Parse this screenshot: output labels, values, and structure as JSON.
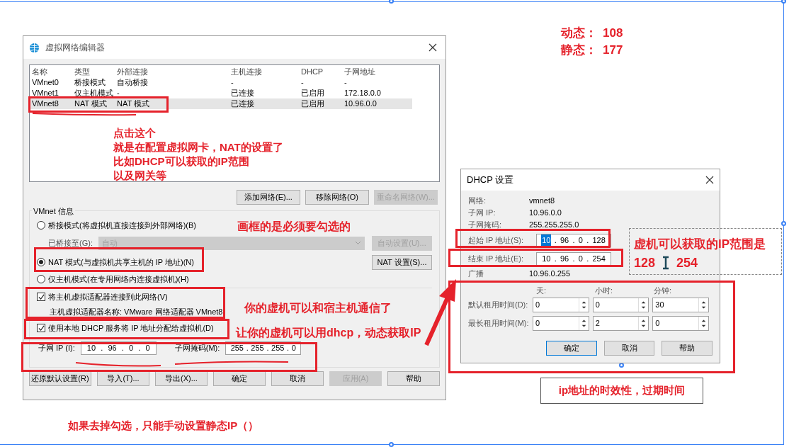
{
  "main_dialog": {
    "title": "虚拟网络编辑器",
    "table": {
      "columns": [
        "名称",
        "类型",
        "外部连接",
        "主机连接",
        "DHCP",
        "子网地址"
      ],
      "rows": [
        {
          "cells": [
            "VMnet0",
            "桥接模式",
            "自动桥接",
            "-",
            "-",
            "-"
          ],
          "selected": false
        },
        {
          "cells": [
            "VMnet1",
            "仅主机模式",
            "-",
            "已连接",
            "已启用",
            "172.18.0.0"
          ],
          "selected": false
        },
        {
          "cells": [
            "VMnet8",
            "NAT 模式",
            "NAT 模式",
            "已连接",
            "已启用",
            "10.96.0.0"
          ],
          "selected": true
        }
      ]
    },
    "list_buttons": [
      {
        "label": "添加网络(E)...",
        "disabled": false
      },
      {
        "label": "移除网络(O)",
        "disabled": false
      },
      {
        "label": "重命名网络(W)...",
        "disabled": true
      }
    ],
    "group_title": "VMnet 信息",
    "radios": [
      {
        "label": "桥接模式(将虚拟机直接连接到外部网络)(B)",
        "selected": false
      },
      {
        "label": "NAT 模式(与虚拟机共享主机的 IP 地址)(N)",
        "selected": true
      },
      {
        "label": "仅主机模式(在专用网络内连接虚拟机)(H)",
        "selected": false
      }
    ],
    "bridged_to": {
      "label": "已桥接至(G):",
      "value": "自动",
      "disabled": true
    },
    "auto_button": {
      "label": "自动设置(U)...",
      "disabled": true
    },
    "nat_button": {
      "label": "NAT 设置(S)...",
      "disabled": false
    },
    "checkboxes": [
      {
        "label": "将主机虚拟适配器连接到此网络(V)",
        "checked": true
      },
      {
        "label": "使用本地 DHCP 服务将 IP 地址分配给虚拟机(D)",
        "checked": true
      }
    ],
    "adapter_name": "主机虚拟适配器名称: VMware 网络适配器 VMnet8",
    "subnet_ip": {
      "label": "子网 IP (I):",
      "separator": ".",
      "octets": [
        {
          "text": "10",
          "selected": false
        },
        {
          "text": "96",
          "selected": false
        },
        {
          "text": "0",
          "selected": false
        },
        {
          "text": "0",
          "selected": false
        }
      ]
    },
    "subnet_mask": {
      "label": "子网掩码(M):",
      "separator": ".",
      "octets": [
        {
          "text": "255",
          "selected": false
        },
        {
          "text": "255",
          "selected": false
        },
        {
          "text": "255",
          "selected": false
        },
        {
          "text": "0",
          "selected": false
        }
      ]
    },
    "bottom_buttons": [
      {
        "label": "还原默认设置(R)",
        "disabled": false
      },
      {
        "label": "导入(T)...",
        "disabled": false
      },
      {
        "label": "导出(X)...",
        "disabled": false
      },
      {
        "label": "确定",
        "disabled": false
      },
      {
        "label": "取消",
        "disabled": false
      },
      {
        "label": "应用(A)",
        "disabled": true
      },
      {
        "label": "帮助",
        "disabled": false
      }
    ]
  },
  "dhcp_dialog": {
    "title": "DHCP 设置",
    "info": [
      {
        "label": "网络:",
        "value": "vmnet8"
      },
      {
        "label": "子网 IP:",
        "value": "10.96.0.0"
      },
      {
        "label": "子网掩码:",
        "value": "255.255.255.0"
      }
    ],
    "start_ip": {
      "label": "起始 IP 地址(S):",
      "separator": ".",
      "octets": [
        {
          "text": "10",
          "selected": true
        },
        {
          "text": "96",
          "selected": false
        },
        {
          "text": "0",
          "selected": false
        },
        {
          "text": "128",
          "selected": false
        }
      ]
    },
    "end_ip": {
      "label": "结束 IP 地址(E):",
      "separator": ".",
      "octets": [
        {
          "text": "10",
          "selected": false
        },
        {
          "text": "96",
          "selected": false
        },
        {
          "text": "0",
          "selected": false
        },
        {
          "text": "254",
          "selected": false
        }
      ]
    },
    "broadcast": {
      "label": "广播",
      "value": "10.96.0.255"
    },
    "lease_columns": [
      "天:",
      "小时:",
      "分钟:"
    ],
    "lease_rows": [
      {
        "label": "默认租用时间(D):",
        "values": [
          "0",
          "0",
          "30"
        ]
      },
      {
        "label": "最长租用时间(M):",
        "values": [
          "0",
          "2",
          "0"
        ]
      }
    ],
    "buttons": [
      {
        "label": "确定",
        "focused": true
      },
      {
        "label": "取消",
        "focused": false
      },
      {
        "label": "帮助",
        "focused": false
      }
    ]
  },
  "annotations": {
    "counts": [
      {
        "label": "动态：",
        "value": "108"
      },
      {
        "label": "静态：",
        "value": "177"
      }
    ],
    "click_note": [
      "点击这个",
      "就是在配置虚拟网卡，NAT的设置了",
      "比如DHCP可以获取的IP范围",
      "以及网关等"
    ],
    "must_check_note": "画框的是必须要勾选的",
    "host_note": "你的虚机可以和宿主机通信了",
    "dhcp_note": "让你的虚机可以用dhcp，动态获取IP",
    "uncheck_note": "如果去掉勾选，只能手动设置静态IP（）",
    "range_note": {
      "title": "虚机可以获取的IP范围是",
      "from": "128",
      "to": "254"
    },
    "lease_note": "ip地址的时效性，过期时间"
  }
}
